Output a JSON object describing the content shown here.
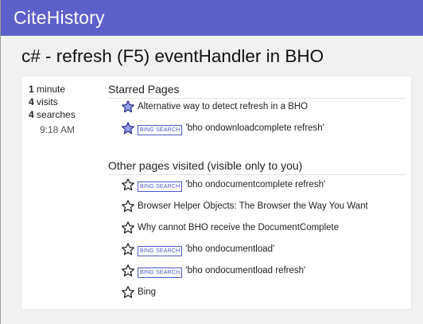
{
  "app": {
    "name": "CiteHistory",
    "brand_color": "#5c60c9"
  },
  "page": {
    "title": "c# - refresh (F5) eventHandler in BHO"
  },
  "stats": {
    "minutes_value": "1",
    "minutes_label": "minute",
    "visits_value": "4",
    "visits_label": "visits",
    "searches_value": "4",
    "searches_label": "searches",
    "time": "9:18 AM"
  },
  "starred": {
    "heading": "Starred Pages",
    "items": [
      {
        "badge": "",
        "text": "Alternative way to detect refresh in a BHO",
        "starred": true,
        "icon": "star-filled-icon"
      },
      {
        "badge": "BING SEARCH",
        "text": "'bho ondownloadcomplete refresh'",
        "starred": true,
        "icon": "star-filled-icon"
      }
    ]
  },
  "other": {
    "heading": "Other pages visited (visible only to you)",
    "items": [
      {
        "badge": "BING SEARCH",
        "text": "'bho ondocumentcomplete refresh'",
        "starred": false,
        "icon": "star-outline-icon"
      },
      {
        "badge": "",
        "text": "Browser Helper Objects: The Browser the Way You Want",
        "starred": false,
        "icon": "star-outline-icon"
      },
      {
        "badge": "",
        "text": "Why cannot BHO receive the DocumentComplete",
        "starred": false,
        "icon": "star-outline-icon"
      },
      {
        "badge": "BING SEARCH",
        "text": "'bho ondocumentload'",
        "starred": false,
        "icon": "star-outline-icon"
      },
      {
        "badge": "BING SEARCH",
        "text": "'bho ondocumentload refresh'",
        "starred": false,
        "icon": "star-outline-icon"
      },
      {
        "badge": "",
        "text": "Bing",
        "starred": false,
        "icon": "star-outline-icon"
      }
    ]
  },
  "colors": {
    "badge": "#4a5ac8",
    "star_fill": "#9aa0e8",
    "star_stroke": "#2b2f8a"
  }
}
